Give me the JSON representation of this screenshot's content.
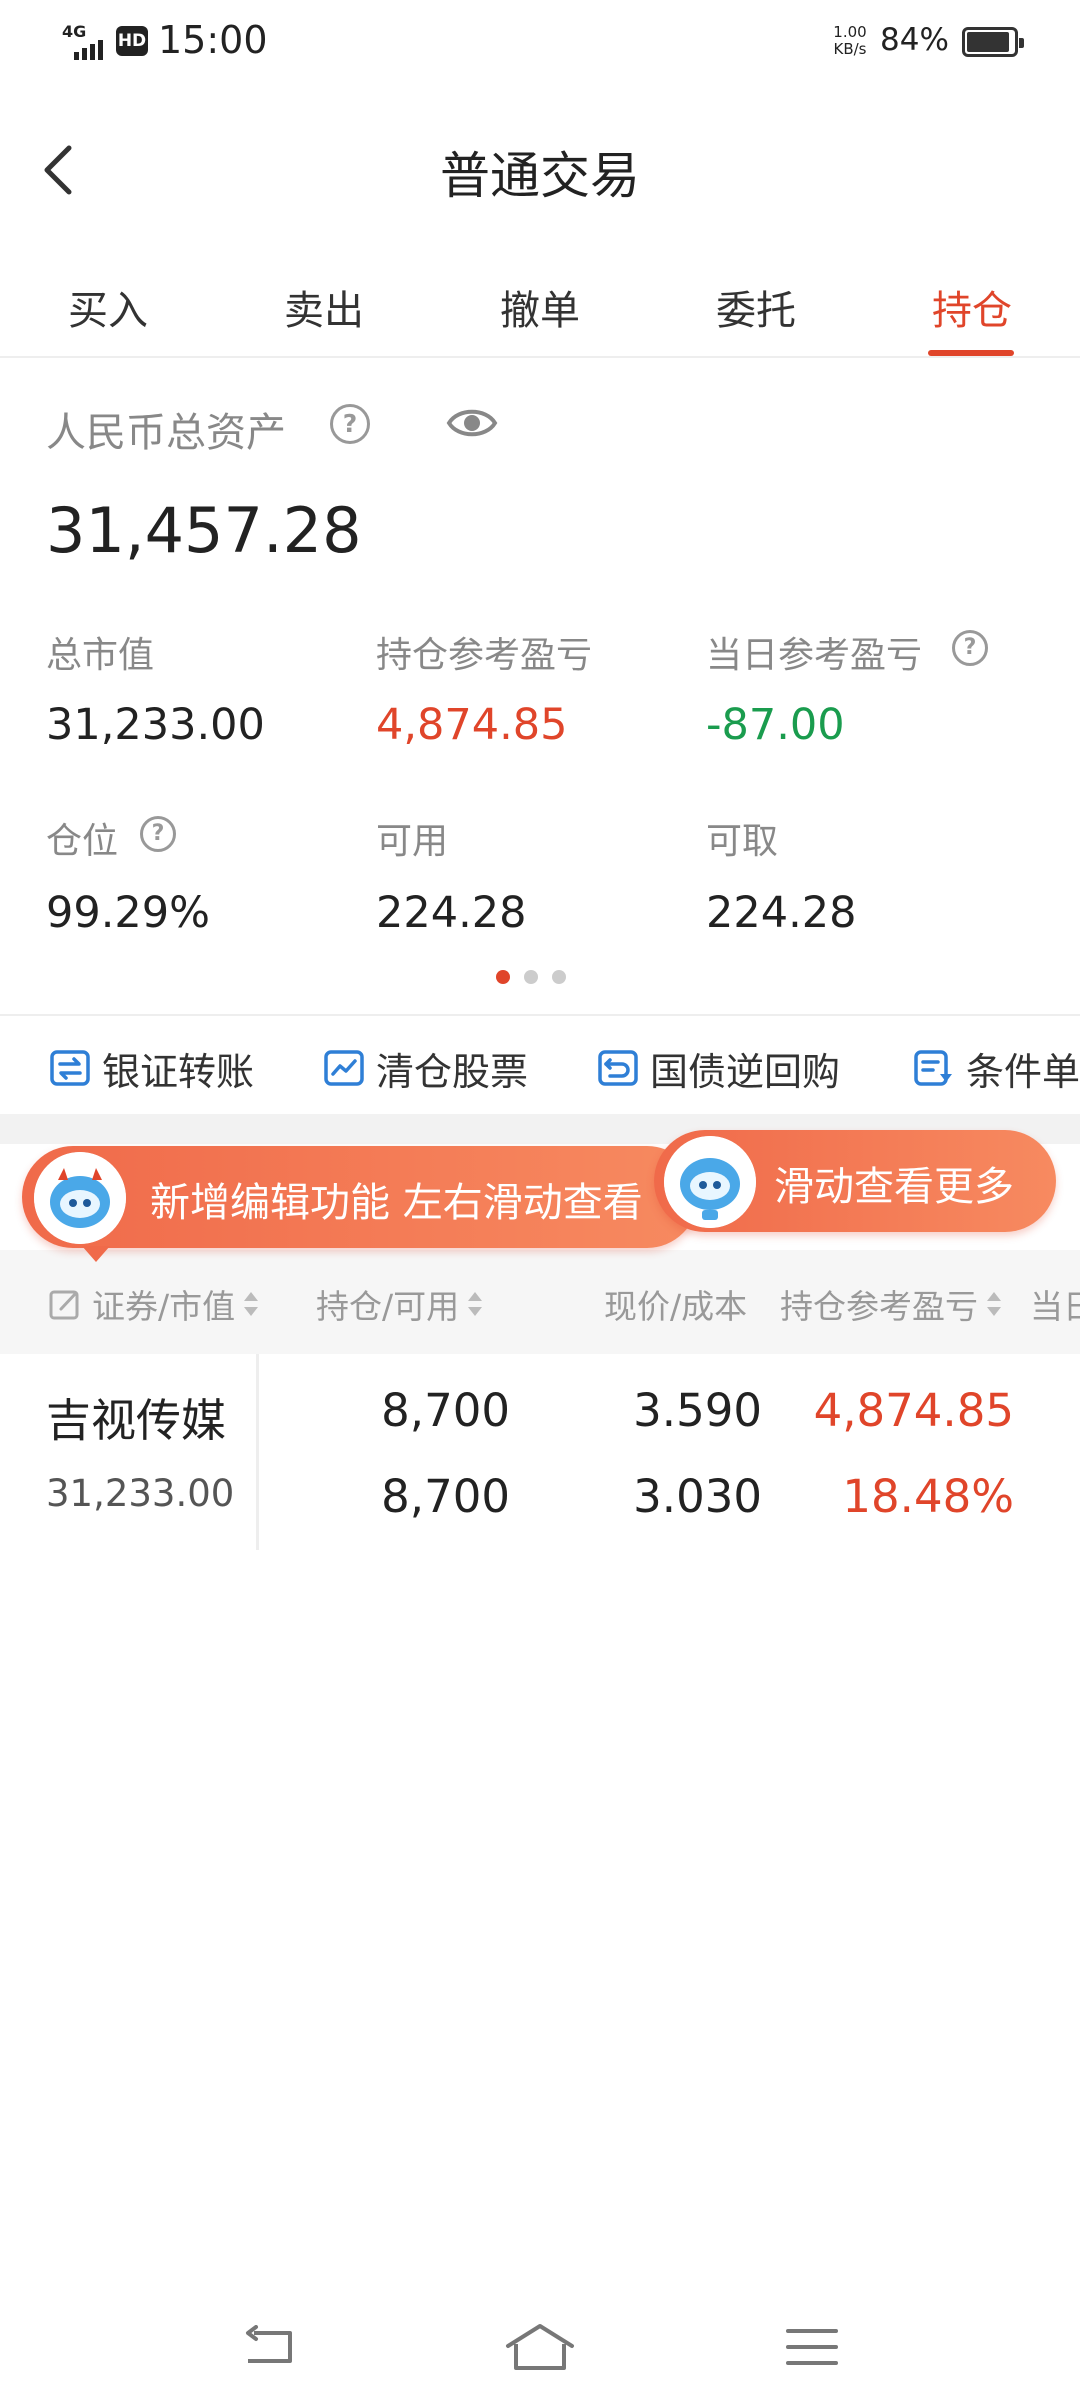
{
  "status_bar": {
    "network": "4G",
    "hd": "HD",
    "time": "15:00",
    "speed_value": "1.00",
    "speed_unit": "KB/s",
    "battery_pct": "84%",
    "battery_level": 0.84
  },
  "header": {
    "title": "普通交易"
  },
  "tabs": [
    {
      "label": "买入",
      "active": false
    },
    {
      "label": "卖出",
      "active": false
    },
    {
      "label": "撤单",
      "active": false
    },
    {
      "label": "委托",
      "active": false
    },
    {
      "label": "持仓",
      "active": true
    }
  ],
  "assets": {
    "total_label": "人民币总资产",
    "total_value": "31,457.28",
    "metrics": [
      {
        "label": "总市值",
        "value": "31,233.00",
        "color": "#222222"
      },
      {
        "label": "持仓参考盈亏",
        "value": "4,874.85",
        "color": "#e0452a"
      },
      {
        "label": "当日参考盈亏",
        "value": "-87.00",
        "color": "#1a9c4e"
      },
      {
        "label": "仓位",
        "value": "99.29%",
        "color": "#222222"
      },
      {
        "label": "可用",
        "value": "224.28",
        "color": "#222222"
      },
      {
        "label": "可取",
        "value": "224.28",
        "color": "#222222"
      }
    ]
  },
  "quick_actions": [
    {
      "label": "银证转账",
      "icon": "transfer-icon"
    },
    {
      "label": "清仓股票",
      "icon": "chart-clear-icon"
    },
    {
      "label": "国债逆回购",
      "icon": "repo-icon"
    },
    {
      "label": "条件单",
      "icon": "condition-order-icon"
    }
  ],
  "banners": {
    "left": "新增编辑功能 左右滑动查看",
    "right": "滑动查看更多"
  },
  "table": {
    "headers": [
      "证券/市值",
      "持仓/可用",
      "现价/成本",
      "持仓参考盈亏",
      "当日"
    ],
    "rows": [
      {
        "name": "吉视传媒",
        "market_value": "31,233.00",
        "position": "8,700",
        "available": "8,700",
        "price": "3.590",
        "cost": "3.030",
        "pnl": "4,874.85",
        "pnl_pct": "18.48%"
      }
    ]
  },
  "colors": {
    "accent": "#e0452a",
    "positive": "#e0452a",
    "negative": "#1a9c4e"
  }
}
